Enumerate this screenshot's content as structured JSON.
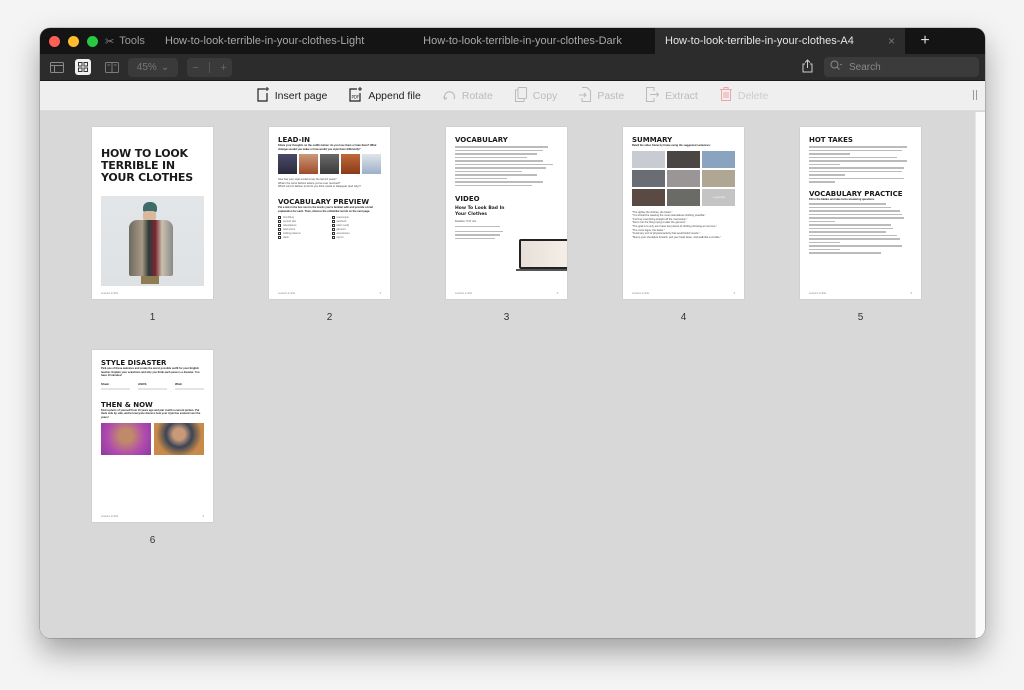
{
  "window": {
    "traffic_lights": {
      "close": "#ff5f57",
      "minimize": "#febc2e",
      "zoom": "#28c840"
    },
    "tabs": [
      {
        "label": "Tools",
        "icon": "tools-icon"
      },
      {
        "label": "How-to-look-terrible-in-your-clothes-Light"
      },
      {
        "label": "How-to-look-terrible-in-your-clothes-Dark"
      },
      {
        "label": "How-to-look-terrible-in-your-clothes-A4",
        "active": true,
        "close": "×"
      }
    ],
    "add_tab": "+"
  },
  "toolbar": {
    "zoom_level": "45%",
    "zoom_chevron": "⌄",
    "zoom_out": "−",
    "zoom_in": "+",
    "search_placeholder": "Search"
  },
  "actions": [
    {
      "label": "Insert page",
      "icon": "insert-page-icon",
      "enabled": true
    },
    {
      "label": "Append file",
      "icon": "append-pdf-icon",
      "enabled": true
    },
    {
      "label": "Rotate",
      "icon": "rotate-icon",
      "enabled": false
    },
    {
      "label": "Copy",
      "icon": "copy-icon",
      "enabled": false
    },
    {
      "label": "Paste",
      "icon": "paste-icon",
      "enabled": false
    },
    {
      "label": "Extract",
      "icon": "extract-icon",
      "enabled": false
    },
    {
      "label": "Delete",
      "icon": "trash-icon",
      "enabled": false
    }
  ],
  "pages": [
    {
      "number": "1",
      "title": "HOW TO LOOK TERRIBLE IN YOUR CLOTHES",
      "footer": "Lessons in ESL"
    },
    {
      "number": "2",
      "title": "LEAD-IN",
      "intro": "Share your thoughts on the outfits below: do you love them or hate them? What changes would you make or how would you style them differently?",
      "questions": [
        "How has your style evolved over the last 10 years?",
        "What's the worst fashion advice you've ever received?",
        "Which current fashion trend do you think needs to disappear (and why)?"
      ],
      "title2": "VOCABULARY PREVIEW",
      "intro2": "Put a tick in the box next to the words you're familiar with and provide a brief explanation for each. Then, discuss the unfamiliar words on the next page.",
      "words": [
        "formfitting",
        "second skin",
        "ostentatious",
        "bold colors",
        "striking patterns",
        "clash",
        "mannequin",
        "aesthetic",
        "tailor (verb)",
        "garment",
        "accessories",
        "opt for"
      ],
      "footer": "Lessons in ESL",
      "page_label": "2"
    },
    {
      "number": "3",
      "title": "VOCABULARY",
      "title2": "VIDEO",
      "video_title": "How To Look Bad In Your Clothes",
      "duration": "Duration: 5:47 min",
      "footer": "Lessons in ESL",
      "page_label": "3"
    },
    {
      "number": "4",
      "title": "SUMMARY",
      "intro": "Retell the video frame by frame using the suggested sentences:",
      "sentences": [
        "\"The tighter the clothes, the better.\"",
        "\"You should be wearing the most ostentatious clothing possible.\"",
        "\"Just buy everything straight off the mannequin.\"",
        "\"Don't ruin the thing trying to alter the garment.\"",
        "\"The goal is to only ever have two pieces of clothing showing at one time.\"",
        "\"The more logos, the better.\"",
        "\"Avoid any sort of physical activity that would build muscle.\"",
        "\"Slump your shoulders forward, pull your head down, and walk like a zombie.\""
      ],
      "bonus_tile": "+ your tip",
      "footer": "Lessons in ESL",
      "page_label": "4"
    },
    {
      "number": "5",
      "title": "HOT TAKES",
      "title2": "VOCABULARY PRACTICE",
      "intro2": "Fill in the blanks and take turns answering questions",
      "footer": "Lessons in ESL",
      "page_label": "5"
    },
    {
      "number": "6",
      "title": "STYLE DISASTER",
      "intro": "Pick one of these websites and create the worst possible outfit for your English teacher. Explain your selections and why you think each piece is a disaster. You have 10 minutes!",
      "sites": [
        "Shein",
        "ASOS",
        "Wish"
      ],
      "title2": "THEN & NOW",
      "intro2": "Find a photo of yourself from 10 years ago and pair it with a current picture. Put them side by side, and let everyone discuss how your style has evolved over the years!",
      "footer": "Lessons in ESL",
      "page_label": "6"
    }
  ]
}
